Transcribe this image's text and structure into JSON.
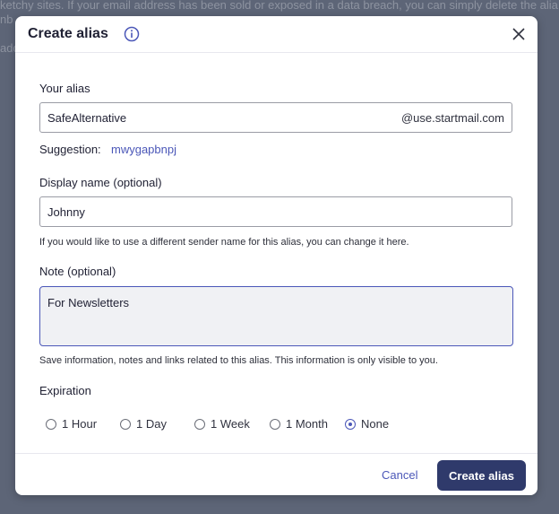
{
  "background": {
    "lines": [
      "ketchy sites. If your email address has been sold or exposed in a data breach, you can simply delete the alia",
      "nb",
      "add"
    ]
  },
  "modal": {
    "title": "Create alias",
    "alias": {
      "label": "Your alias",
      "value": "SafeAlternative",
      "domain": "@use.startmail.com"
    },
    "suggestion": {
      "label": "Suggestion:",
      "value": "mwygapbnpj"
    },
    "display_name": {
      "label": "Display name (optional)",
      "value": "Johnny",
      "helper": "If you would like to use a different sender name for this alias, you can change it here."
    },
    "note": {
      "label": "Note (optional)",
      "value": "For Newsletters",
      "helper": "Save information, notes and links related to this alias. This information is only visible to you."
    },
    "expiration": {
      "label": "Expiration",
      "options": [
        "1 Hour",
        "1 Day",
        "1 Week",
        "1 Month",
        "None"
      ],
      "selected": "None"
    },
    "buttons": {
      "cancel": "Cancel",
      "create": "Create alias"
    }
  },
  "colors": {
    "accent": "#4b57b8",
    "primary_button": "#2f3a6b",
    "overlay": "#5d6577"
  },
  "icons": {
    "info": "info-icon",
    "close": "close-icon"
  }
}
